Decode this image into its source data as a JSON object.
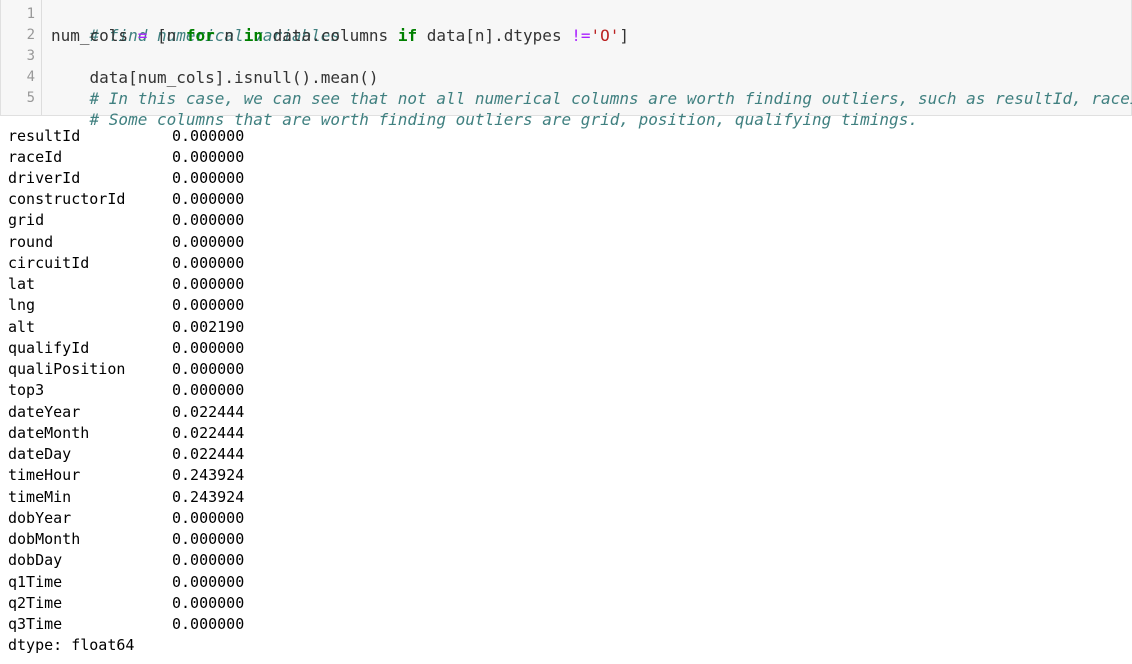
{
  "code_cell": {
    "line_numbers": [
      "1",
      "2",
      "3",
      "4",
      "5"
    ],
    "lines": [
      {
        "comment": "# find numerical variables"
      },
      {
        "p1": "num_cols ",
        "op1": "=",
        "p2": " [n ",
        "kw1": "for",
        "p3": " n ",
        "kw2": "in",
        "p4": " data.columns ",
        "kw3": "if",
        "p5": " data[n].dtypes ",
        "op2": "!=",
        "str1": "'O'",
        "p6": "]"
      },
      {
        "text": "data[num_cols].isnull().mean()"
      },
      {
        "comment": "# In this case, we can see that not all numerical columns are worth finding outliers, such as resultId, raceId."
      },
      {
        "comment": "# Some columns that are worth finding outliers are grid, position, qualifying timings."
      }
    ]
  },
  "output": {
    "rows": [
      {
        "name": "resultId",
        "value": "0.000000"
      },
      {
        "name": "raceId",
        "value": "0.000000"
      },
      {
        "name": "driverId",
        "value": "0.000000"
      },
      {
        "name": "constructorId",
        "value": "0.000000"
      },
      {
        "name": "grid",
        "value": "0.000000"
      },
      {
        "name": "round",
        "value": "0.000000"
      },
      {
        "name": "circuitId",
        "value": "0.000000"
      },
      {
        "name": "lat",
        "value": "0.000000"
      },
      {
        "name": "lng",
        "value": "0.000000"
      },
      {
        "name": "alt",
        "value": "0.002190"
      },
      {
        "name": "qualifyId",
        "value": "0.000000"
      },
      {
        "name": "qualiPosition",
        "value": "0.000000"
      },
      {
        "name": "top3",
        "value": "0.000000"
      },
      {
        "name": "dateYear",
        "value": "0.022444"
      },
      {
        "name": "dateMonth",
        "value": "0.022444"
      },
      {
        "name": "dateDay",
        "value": "0.022444"
      },
      {
        "name": "timeHour",
        "value": "0.243924"
      },
      {
        "name": "timeMin",
        "value": "0.243924"
      },
      {
        "name": "dobYear",
        "value": "0.000000"
      },
      {
        "name": "dobMonth",
        "value": "0.000000"
      },
      {
        "name": "dobDay",
        "value": "0.000000"
      },
      {
        "name": "q1Time",
        "value": "0.000000"
      },
      {
        "name": "q2Time",
        "value": "0.000000"
      },
      {
        "name": "q3Time",
        "value": "0.000000"
      }
    ],
    "dtype": "dtype: float64"
  }
}
